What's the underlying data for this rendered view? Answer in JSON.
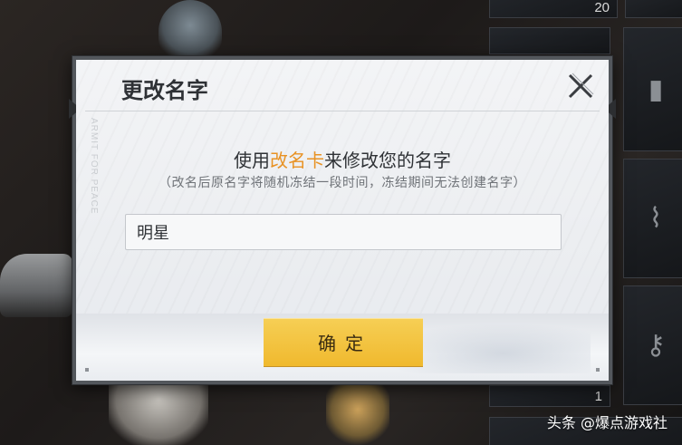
{
  "dialog": {
    "title": "更改名字",
    "side_text": "ARMIT FOR PEACE",
    "heading_before": "使用",
    "heading_highlight": "改名卡",
    "heading_after": "来修改您的名字",
    "subheading": "（改名后原名字将随机冻结一段时间，冻结期间无法创建名字）",
    "name_input_value": "明星",
    "confirm_label": "确定",
    "close_icon": "close-icon",
    "highlight_color": "#e89224",
    "confirm_color": "#f2c040"
  },
  "inventory": {
    "slots": [
      {
        "count": "20",
        "icon": "item-icon"
      },
      {
        "count": "",
        "icon": "item-icon"
      },
      {
        "count": "",
        "icon": "item-icon"
      },
      {
        "count": "",
        "icon": "spring-icon"
      },
      {
        "count": "",
        "icon": "key-icon"
      },
      {
        "count": "1",
        "icon": "item-icon"
      }
    ]
  },
  "credit": "头条 @爆点游戏社"
}
